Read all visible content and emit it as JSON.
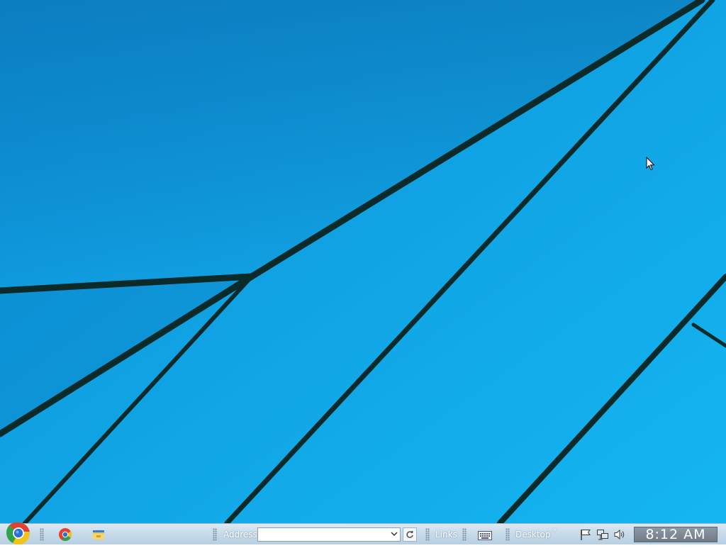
{
  "desktop": {
    "wallpaper": "blue-geometric-lines",
    "colors": {
      "sky_light": "#12b0ee",
      "sky_dark": "#0a6fb0",
      "line": "#0b2a2a"
    }
  },
  "taskbar": {
    "start_icon": "chrome-orb-icon",
    "quick_launch": [
      {
        "name": "Google Chrome",
        "icon": "chrome-icon"
      },
      {
        "name": "File Explorer",
        "icon": "folder-icon"
      }
    ],
    "address_label": "Address",
    "address_value": "",
    "links_label": "Links",
    "desktop_label": "Desktop",
    "desktop_chevron": "»",
    "tray_icons": [
      "keyboard-icon",
      "flag-icon",
      "network-icon",
      "volume-icon"
    ],
    "clock": "8:12 AM"
  }
}
